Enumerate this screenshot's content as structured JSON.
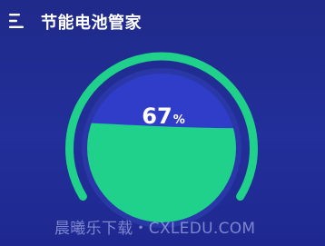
{
  "header": {
    "title": "节能电池管家",
    "menu_icon": "menu-icon"
  },
  "battery": {
    "level_value": "67",
    "level_unit": "%",
    "level_fraction": 0.67
  },
  "watermark": {
    "text": "晨曦乐下载・CXLEDU.COM"
  },
  "colors": {
    "background": "#2230a0",
    "ring": "#1fd18a",
    "ring_track": "#2a37a6",
    "fill": "#1fd18a",
    "empty": "#2f3dc8"
  }
}
